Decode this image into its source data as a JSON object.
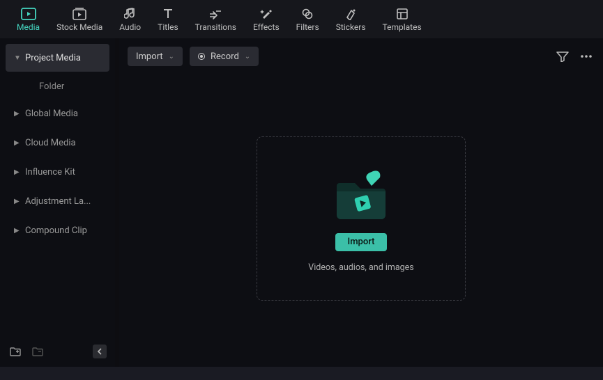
{
  "nav": [
    {
      "id": "media",
      "label": "Media",
      "active": true
    },
    {
      "id": "stock-media",
      "label": "Stock Media",
      "active": false
    },
    {
      "id": "audio",
      "label": "Audio",
      "active": false
    },
    {
      "id": "titles",
      "label": "Titles",
      "active": false
    },
    {
      "id": "transitions",
      "label": "Transitions",
      "active": false
    },
    {
      "id": "effects",
      "label": "Effects",
      "active": false
    },
    {
      "id": "filters",
      "label": "Filters",
      "active": false
    },
    {
      "id": "stickers",
      "label": "Stickers",
      "active": false
    },
    {
      "id": "templates",
      "label": "Templates",
      "active": false
    }
  ],
  "sidebar": {
    "items": [
      {
        "id": "project-media",
        "label": "Project Media",
        "expanded": true,
        "children": [
          {
            "label": "Folder"
          }
        ]
      },
      {
        "id": "global-media",
        "label": "Global Media",
        "expanded": false
      },
      {
        "id": "cloud-media",
        "label": "Cloud Media",
        "expanded": false
      },
      {
        "id": "influence-kit",
        "label": "Influence Kit",
        "expanded": false
      },
      {
        "id": "adjustment-layer",
        "label": "Adjustment La...",
        "expanded": false
      },
      {
        "id": "compound-clip",
        "label": "Compound Clip",
        "expanded": false
      }
    ]
  },
  "toolbar": {
    "import_label": "Import",
    "record_label": "Record"
  },
  "dropzone": {
    "button": "Import",
    "hint": "Videos, audios, and images"
  },
  "colors": {
    "accent": "#3bbfa8"
  }
}
